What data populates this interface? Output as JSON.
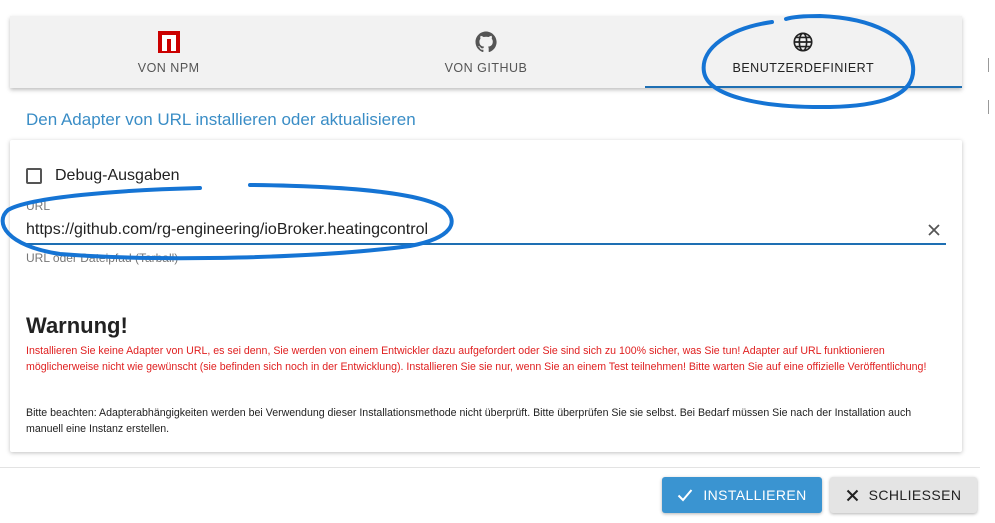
{
  "tabs": [
    {
      "label": "VON NPM",
      "icon": "npm-icon"
    },
    {
      "label": "VON GITHUB",
      "icon": "github-icon"
    },
    {
      "label": "BENUTZERDEFINIERT",
      "icon": "globe-icon",
      "active": true
    }
  ],
  "dialog": {
    "title": "Den Adapter von URL installieren oder aktualisieren"
  },
  "form": {
    "debug_label": "Debug-Ausgaben",
    "debug_checked": false,
    "url_label": "URL",
    "url_value": "https://github.com/rg-engineering/ioBroker.heatingcontrol",
    "url_helper": "URL oder Dateipfad (Tarball)"
  },
  "warning": {
    "title": "Warnung!",
    "text": "Installieren Sie keine Adapter von URL, es sei denn, Sie werden von einem Entwickler dazu aufgefordert oder Sie sind sich zu 100% sicher, was Sie tun! Adapter auf URL funktionieren möglicherweise nicht wie gewünscht (sie befinden sich noch in der Entwicklung). Installieren Sie sie nur, wenn Sie an einem Test teilnehmen! Bitte warten Sie auf eine offizielle Veröffentlichung!",
    "note": "Bitte beachten: Adapterabhängigkeiten werden bei Verwendung dieser Installationsmethode nicht überprüft. Bitte überprüfen Sie sie selbst. Bei Bedarf müssen Sie nach der Installation auch manuell eine Instanz erstellen."
  },
  "buttons": {
    "install_label": "INSTALLIEREN",
    "close_label": "SCHLIESSEN"
  },
  "colors": {
    "accent": "#1e6fb3",
    "primary_button": "#3a94d1",
    "warning_text": "#e02020",
    "title_text": "#3a8dc6",
    "npm_red": "#cb0000",
    "annotation_blue": "#1574d4"
  }
}
